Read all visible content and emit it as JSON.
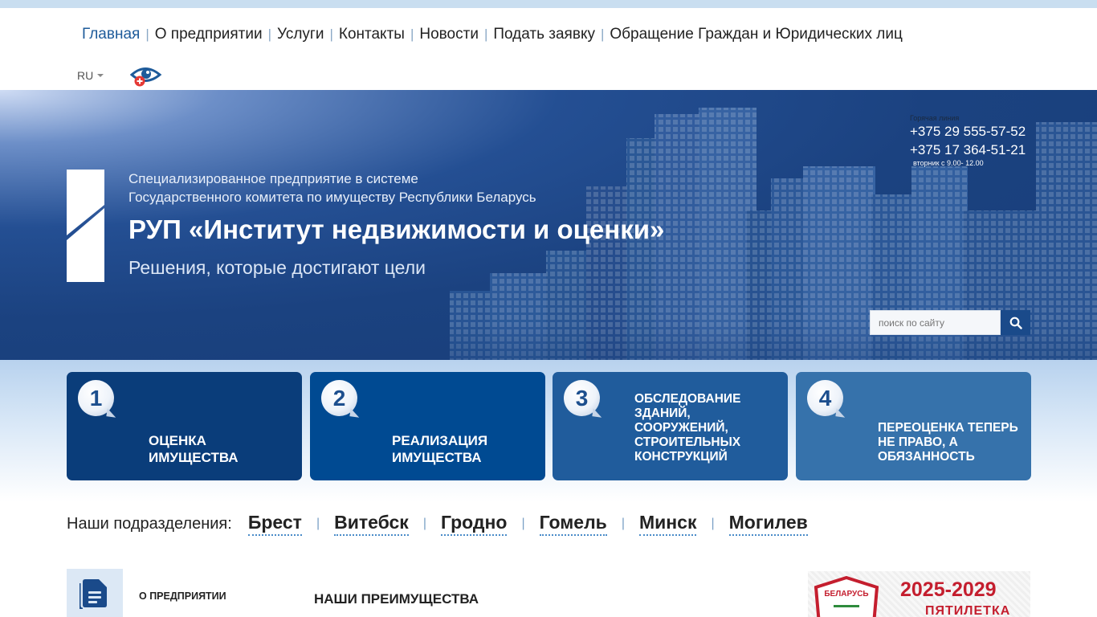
{
  "nav": {
    "items": [
      {
        "label": "Главная",
        "active": true
      },
      {
        "label": "О предприятии"
      },
      {
        "label": "Услуги"
      },
      {
        "label": "Контакты"
      },
      {
        "label": "Новости"
      },
      {
        "label": "Подать заявку"
      },
      {
        "label": "Обращение Граждан и Юридических лиц"
      }
    ],
    "separator": "|"
  },
  "lang": {
    "current": "RU"
  },
  "accessibility": {
    "icon": "eye-icon"
  },
  "hero": {
    "subtitle_line1": "Специализированное предприятие в системе",
    "subtitle_line2": "Государственного комитета по имуществу Республики Беларусь",
    "title": "РУП «Институт недвижимости и оценки»",
    "slogan": "Решения, которые достигают цели",
    "hotline": {
      "label": "Горячая линия",
      "phone1": "+375 29 555-57-52",
      "phone2": "+375 17 364-51-21",
      "hours": "вторник с 9.00- 12.00"
    },
    "search": {
      "placeholder": "поиск по сайту",
      "icon": "search-icon"
    }
  },
  "services": [
    {
      "num": "1",
      "label": "Оценка имущества",
      "color": "#0a3d7a"
    },
    {
      "num": "2",
      "label": "Реализация имущества",
      "color": "#004a92"
    },
    {
      "num": "3",
      "label": "Обследование зданий, сооружений, строительных конструкций",
      "color": "#205c9c"
    },
    {
      "num": "4",
      "label": "Переоценка теперь не право, а обязанность",
      "color": "#3672ab"
    }
  ],
  "divisions": {
    "label": "Наши подразделения:",
    "cities": [
      "Брест",
      "Витебск",
      "Гродно",
      "Гомель",
      "Минск",
      "Могилев"
    ]
  },
  "bottom": {
    "about_label": "О ПРЕДПРИЯТИИ",
    "advantages_title": "НАШИ ПРЕИМУЩЕСТВА",
    "banner": {
      "years": "2025-2029",
      "caption": "ПЯТИЛЕТКА",
      "emblem_text": "БЕЛАРУСЬ"
    }
  },
  "colors": {
    "accent": "#1e5b9a",
    "hero_dark": "#183d78",
    "banner_red": "#c41e2e"
  }
}
